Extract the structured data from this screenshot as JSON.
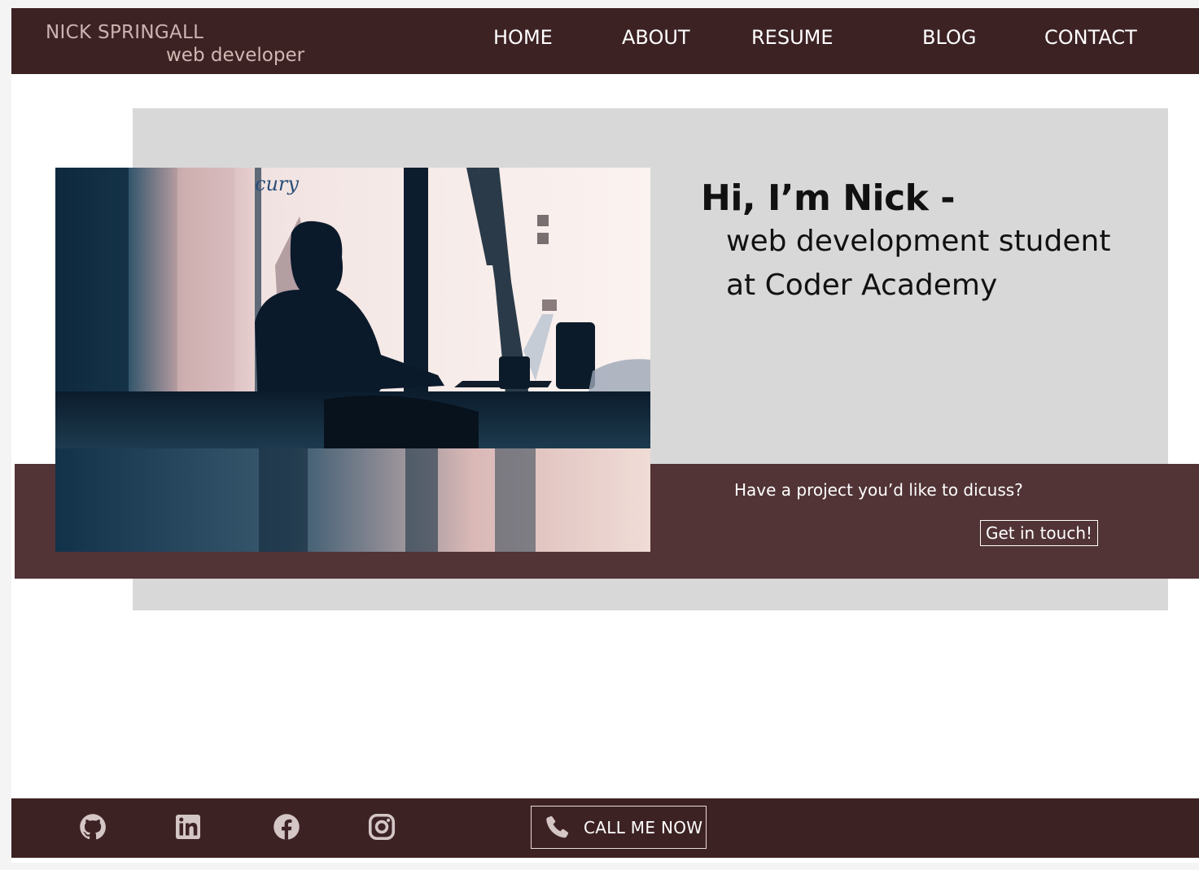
{
  "header": {
    "brand_name": "NICK SPRINGALL",
    "brand_role": "web developer",
    "nav": [
      "HOME",
      "ABOUT",
      "RESUME",
      "BLOG",
      "CONTACT"
    ]
  },
  "hero": {
    "greeting": "Hi, I’m Nick -",
    "subtitle": "web development student at Coder Academy",
    "image": "person-at-laptop-cafe-photo",
    "sign_text": "cury"
  },
  "cta": {
    "text": "Have a project you’d like to dicuss?",
    "button_label": "Get in touch!"
  },
  "footer": {
    "social": [
      "github-icon",
      "linkedin-icon",
      "facebook-icon",
      "instagram-icon"
    ],
    "call_label": "CALL ME NOW",
    "call_icon": "phone-icon"
  },
  "colors": {
    "header_bg": "#3d2224",
    "band_bg": "#523436",
    "hero_gray": "#d8d8d8",
    "brand_text": "#ccb3b1"
  }
}
